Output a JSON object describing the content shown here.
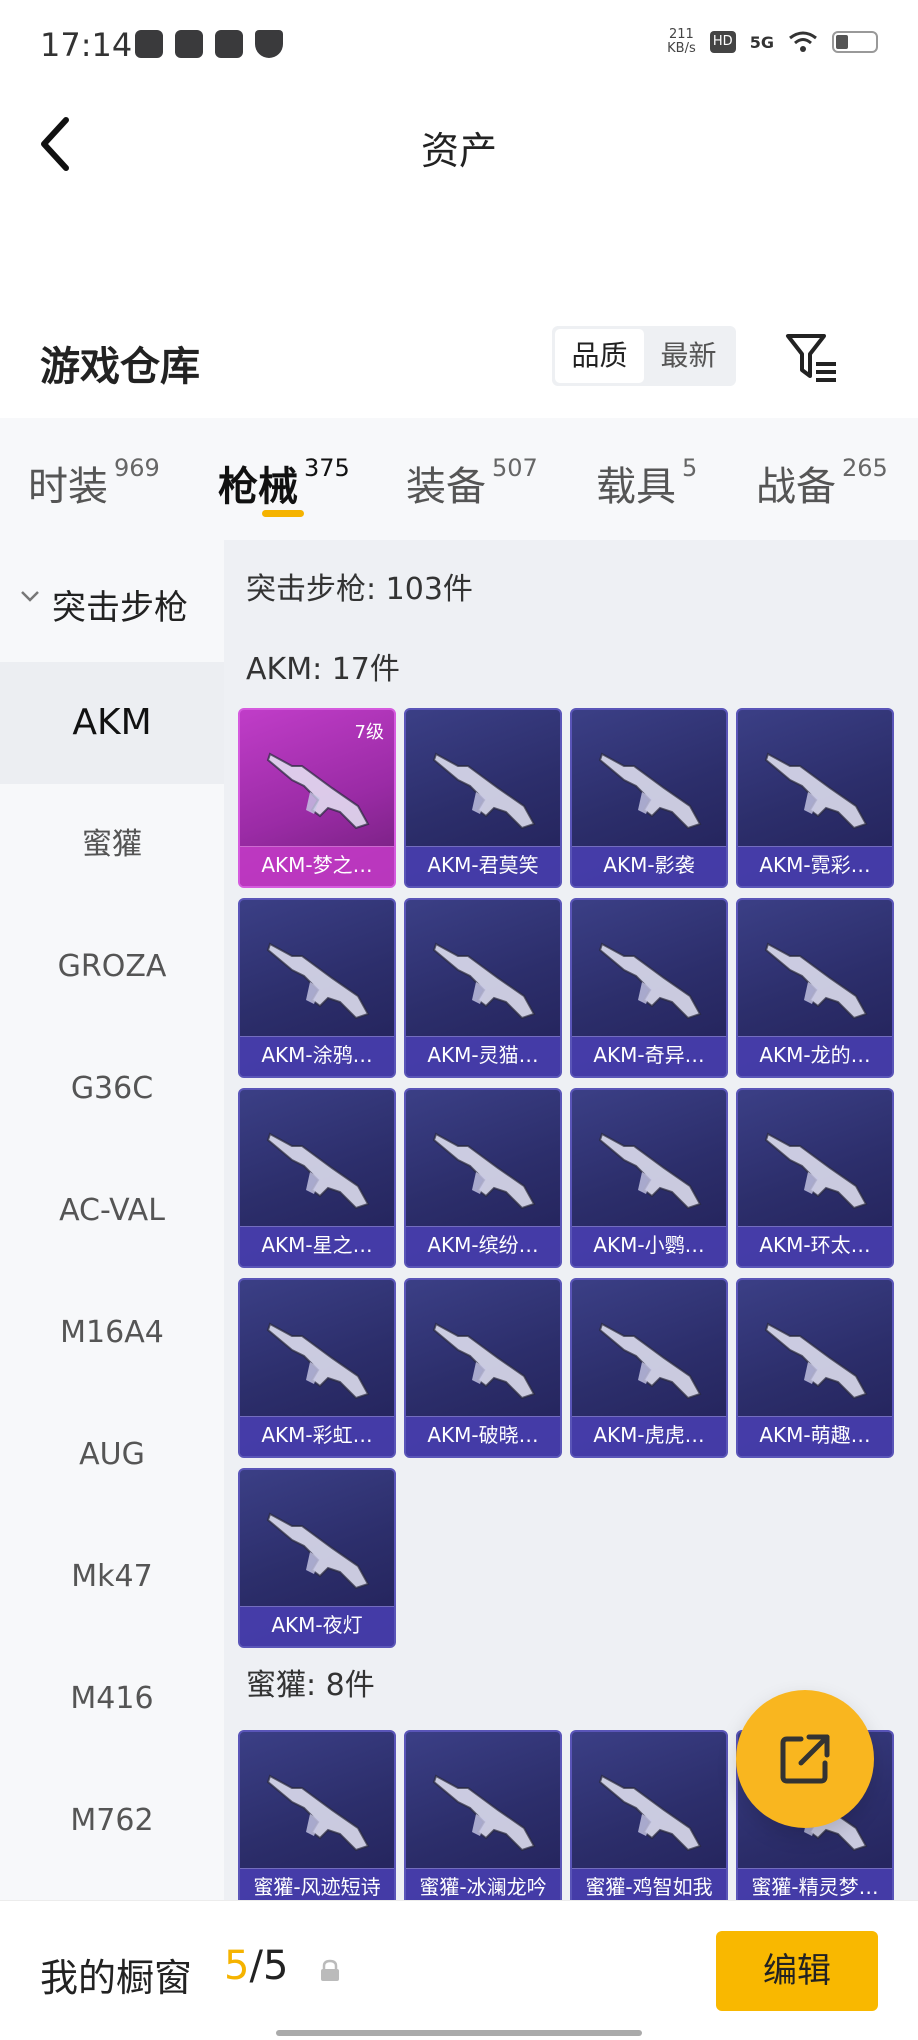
{
  "status_bar": {
    "time": "17:14",
    "net_speed_value": "211",
    "net_speed_unit": "KB/s",
    "hd": "HD",
    "signal": "5G"
  },
  "header": {
    "title": "资产"
  },
  "warehouse": {
    "title": "游戏仓库",
    "sort_options": [
      "品质",
      "最新"
    ],
    "active_sort": "品质"
  },
  "tabs": [
    {
      "label": "时装",
      "count": "969"
    },
    {
      "label": "枪械",
      "count": "375",
      "active": true
    },
    {
      "label": "装备",
      "count": "507"
    },
    {
      "label": "载具",
      "count": "5"
    },
    {
      "label": "战备",
      "count": "265"
    }
  ],
  "sidebar": {
    "category": "突击步枪",
    "items": [
      "AKM",
      "蜜獾",
      "GROZA",
      "G36C",
      "AC-VAL",
      "M16A4",
      "AUG",
      "Mk47",
      "M416",
      "M762"
    ],
    "active": "AKM"
  },
  "content": {
    "summary": "突击步枪: 103件",
    "groups": [
      {
        "title": "AKM: 17件",
        "items": [
          {
            "name": "AKM-梦之…",
            "level": "7级",
            "style": "pink"
          },
          {
            "name": "AKM-君莫笑"
          },
          {
            "name": "AKM-影袭"
          },
          {
            "name": "AKM-霓彩…"
          },
          {
            "name": "AKM-涂鸦…"
          },
          {
            "name": "AKM-灵猫…"
          },
          {
            "name": "AKM-奇异…"
          },
          {
            "name": "AKM-龙的…"
          },
          {
            "name": "AKM-星之…"
          },
          {
            "name": "AKM-缤纷…"
          },
          {
            "name": "AKM-小鹦…"
          },
          {
            "name": "AKM-环太…"
          },
          {
            "name": "AKM-彩虹…"
          },
          {
            "name": "AKM-破晓…"
          },
          {
            "name": "AKM-虎虎…"
          },
          {
            "name": "AKM-萌趣…"
          },
          {
            "name": "AKM-夜灯"
          }
        ]
      },
      {
        "title": "蜜獾: 8件",
        "items": [
          {
            "name": "蜜獾-风迹短诗"
          },
          {
            "name": "蜜獾-冰澜龙吟"
          },
          {
            "name": "蜜獾-鸡智如我"
          },
          {
            "name": "蜜獾-精灵梦…"
          }
        ]
      }
    ]
  },
  "bottom_bar": {
    "label": "我的橱窗",
    "current": "5",
    "separator": "/",
    "total": "5",
    "edit_label": "编辑"
  },
  "colors": {
    "accent": "#f9b800",
    "card_bg": "#2c2e6b",
    "card_pink": "#b034bc"
  }
}
